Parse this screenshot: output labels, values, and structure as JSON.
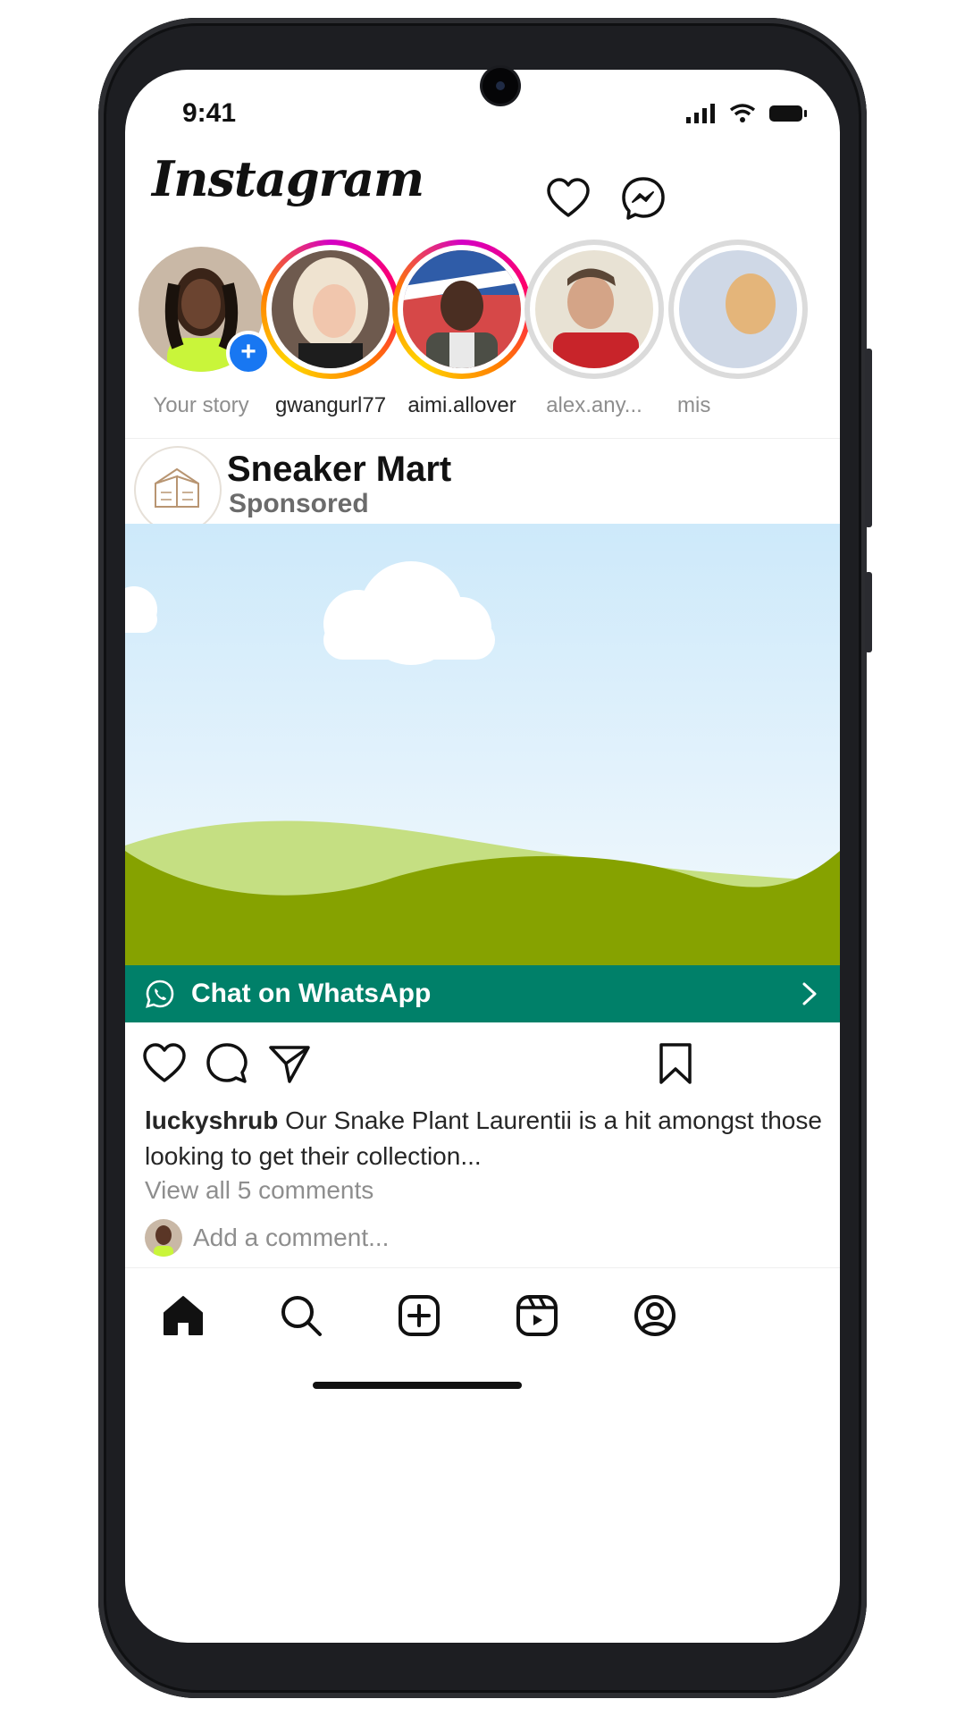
{
  "status_bar": {
    "time": "9:41"
  },
  "header": {
    "logo": "Instagram"
  },
  "stories": [
    {
      "label": "Your story"
    },
    {
      "label": "gwangurl77"
    },
    {
      "label": "aimi.allover"
    },
    {
      "label": "alex.any..."
    },
    {
      "label": "mis"
    }
  ],
  "post": {
    "brand_name": "Sneaker Mart",
    "sponsored_label": "Sponsored",
    "cta_label": "Chat on WhatsApp",
    "caption_user": "luckyshrub",
    "caption_text": " Our Snake Plant Laurentii is a hit amongst those looking to get their collection...",
    "view_comments": "View all 5 comments",
    "comment_placeholder": "Add a comment..."
  },
  "colors": {
    "whatsapp_green": "#008069",
    "story_blue": "#1877f2",
    "sky": "#cfeaf9",
    "hill_light": "#c5df82",
    "hill_dark": "#86a200"
  }
}
